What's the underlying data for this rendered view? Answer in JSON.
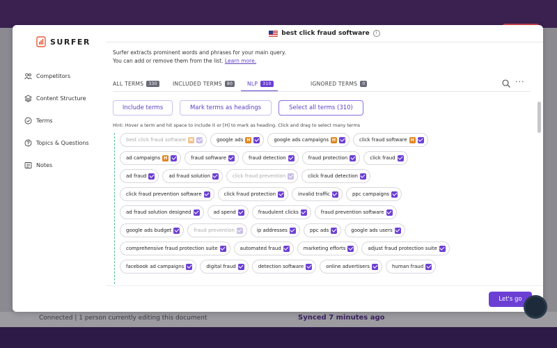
{
  "app": {
    "logo_text": "SURFER",
    "brand_color": "#6c3fd4"
  },
  "background": {
    "status_text": "Connected | 1 person currently editing this document",
    "synced_text": "Synced 7 minutes ago"
  },
  "sidebar": {
    "items": [
      {
        "label": "Competitors",
        "icon": "users-icon"
      },
      {
        "label": "Content Structure",
        "icon": "layers-icon"
      },
      {
        "label": "Terms",
        "icon": "check-circle-icon"
      },
      {
        "label": "Topics & Questions",
        "icon": "question-icon"
      },
      {
        "label": "Notes",
        "icon": "notes-icon"
      }
    ]
  },
  "header": {
    "query": "best click fraud software",
    "info": "i"
  },
  "description": {
    "line1": "Surfer extracts prominent words and phrases for your main query.",
    "line2": "You can add or remove them from the list.",
    "link": "Learn more."
  },
  "tabs": [
    {
      "label": "ALL TERMS",
      "count": "330"
    },
    {
      "label": "INCLUDED TERMS",
      "count": "80"
    },
    {
      "label": "NLP",
      "count": "310",
      "active": true
    },
    {
      "label": "IGNORED TERMS",
      "count": "0"
    }
  ],
  "toolbar": {
    "more": "···"
  },
  "actions": {
    "include": "Include terms",
    "headings": "Mark terms as headings",
    "select_all": "Select all terms (310)"
  },
  "hint": "Hint: Hover a term and hit space to include it or [H] to mark as heading. Click and drag to select many terms",
  "terms": [
    [
      {
        "t": "best click fraud software",
        "h": true,
        "dim": true
      },
      {
        "t": "google ads",
        "h": true
      },
      {
        "t": "google ads campaigns",
        "h": true
      },
      {
        "t": "click fraud software",
        "h": true
      }
    ],
    [
      {
        "t": "ad campaigns",
        "h": true
      },
      {
        "t": "fraud software"
      },
      {
        "t": "fraud detection"
      },
      {
        "t": "fraud protection"
      },
      {
        "t": "click fraud"
      }
    ],
    [
      {
        "t": "ad fraud"
      },
      {
        "t": "ad fraud solution"
      },
      {
        "t": "click fraud prevention",
        "dim": true
      },
      {
        "t": "click fraud detection"
      }
    ],
    [
      {
        "t": "click fraud prevention software"
      },
      {
        "t": "click fraud protection"
      },
      {
        "t": "invalid traffic"
      },
      {
        "t": "ppc campaigns"
      }
    ],
    [
      {
        "t": "ad fraud solution designed"
      },
      {
        "t": "ad spend"
      },
      {
        "t": "fraudulent clicks"
      },
      {
        "t": "fraud prevention software"
      }
    ],
    [
      {
        "t": "google ads budget"
      },
      {
        "t": "fraud prevention",
        "dim": true
      },
      {
        "t": "ip addresses"
      },
      {
        "t": "ppc ads"
      },
      {
        "t": "google ads users"
      }
    ],
    [
      {
        "t": "comprehensive fraud protection suite"
      },
      {
        "t": "automated fraud"
      },
      {
        "t": "marketing efforts"
      },
      {
        "t": "adjust fraud protection suite"
      }
    ],
    [
      {
        "t": "facebook ad campaigns"
      },
      {
        "t": "digital fraud"
      },
      {
        "t": "detection software"
      },
      {
        "t": "online advertisers"
      },
      {
        "t": "human fraud"
      }
    ]
  ],
  "cta": "Let's go"
}
